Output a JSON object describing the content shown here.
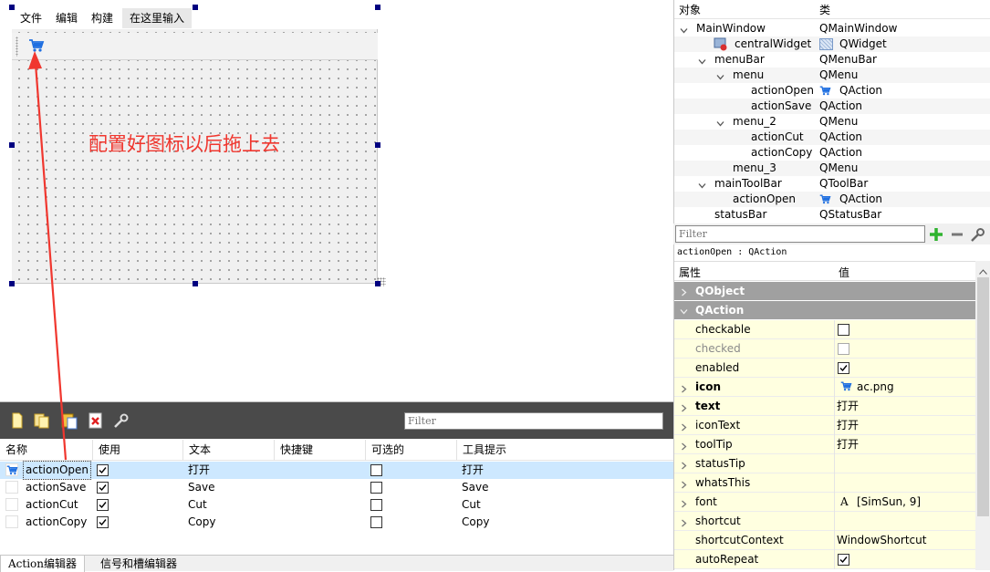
{
  "form": {
    "menu": [
      "文件",
      "编辑",
      "构建"
    ],
    "menu_input": "在这里输入",
    "annotation": "配置好图标以后拖上去"
  },
  "action_editor": {
    "filter_placeholder": "Filter",
    "columns": [
      "名称",
      "使用",
      "文本",
      "快捷键",
      "可选的",
      "工具提示"
    ],
    "rows": [
      {
        "name": "actionOpen",
        "used": true,
        "text": "打开",
        "shortcut": "",
        "checkable": false,
        "tooltip": "打开",
        "icon": "cart-icon",
        "selected": true
      },
      {
        "name": "actionSave",
        "used": true,
        "text": "Save",
        "shortcut": "",
        "checkable": false,
        "tooltip": "Save",
        "icon": "",
        "selected": false
      },
      {
        "name": "actionCut",
        "used": true,
        "text": "Cut",
        "shortcut": "",
        "checkable": false,
        "tooltip": "Cut",
        "icon": "",
        "selected": false
      },
      {
        "name": "actionCopy",
        "used": true,
        "text": "Copy",
        "shortcut": "",
        "checkable": false,
        "tooltip": "Copy",
        "icon": "",
        "selected": false
      }
    ],
    "tabs": [
      "Action编辑器",
      "信号和槽编辑器"
    ]
  },
  "object_inspector": {
    "headers": [
      "对象",
      "类"
    ],
    "rows": [
      {
        "name": "MainWindow",
        "class": "QMainWindow"
      },
      {
        "name": "centralWidget",
        "class": "QWidget"
      },
      {
        "name": "menuBar",
        "class": "QMenuBar"
      },
      {
        "name": "menu",
        "class": "QMenu"
      },
      {
        "name": "actionOpen",
        "class": "QAction"
      },
      {
        "name": "actionSave",
        "class": "QAction"
      },
      {
        "name": "menu_2",
        "class": "QMenu"
      },
      {
        "name": "actionCut",
        "class": "QAction"
      },
      {
        "name": "actionCopy",
        "class": "QAction"
      },
      {
        "name": "menu_3",
        "class": "QMenu"
      },
      {
        "name": "mainToolBar",
        "class": "QToolBar"
      },
      {
        "name": "actionOpen",
        "class": "QAction"
      },
      {
        "name": "statusBar",
        "class": "QStatusBar"
      }
    ],
    "filter_placeholder": "Filter"
  },
  "property_editor": {
    "object_label": "actionOpen : QAction",
    "headers": [
      "属性",
      "值"
    ],
    "groups": [
      "QObject",
      "QAction"
    ],
    "properties": [
      {
        "name": "checkable",
        "value": "",
        "type": "checkbox",
        "checked": false
      },
      {
        "name": "checked",
        "value": "",
        "type": "checkbox",
        "checked": false
      },
      {
        "name": "enabled",
        "value": "",
        "type": "checkbox",
        "checked": true
      },
      {
        "name": "icon",
        "value": "ac.png",
        "type": "icon"
      },
      {
        "name": "text",
        "value": "打开",
        "type": "text"
      },
      {
        "name": "iconText",
        "value": "打开",
        "type": "text"
      },
      {
        "name": "toolTip",
        "value": "打开",
        "type": "text"
      },
      {
        "name": "statusTip",
        "value": "",
        "type": "text"
      },
      {
        "name": "whatsThis",
        "value": "",
        "type": "text"
      },
      {
        "name": "font",
        "value": "[SimSun, 9]",
        "type": "font"
      },
      {
        "name": "shortcut",
        "value": "",
        "type": "text"
      },
      {
        "name": "shortcutContext",
        "value": "WindowShortcut",
        "type": "text"
      },
      {
        "name": "autoRepeat",
        "value": "",
        "type": "checkbox",
        "checked": true
      }
    ]
  },
  "colors": {
    "annotation": "#f0372f",
    "selection": "#cde8ff",
    "property_bg": "#ffffe0",
    "group_bg": "#a0a0a0",
    "cart_icon": "#1f6fe0"
  }
}
